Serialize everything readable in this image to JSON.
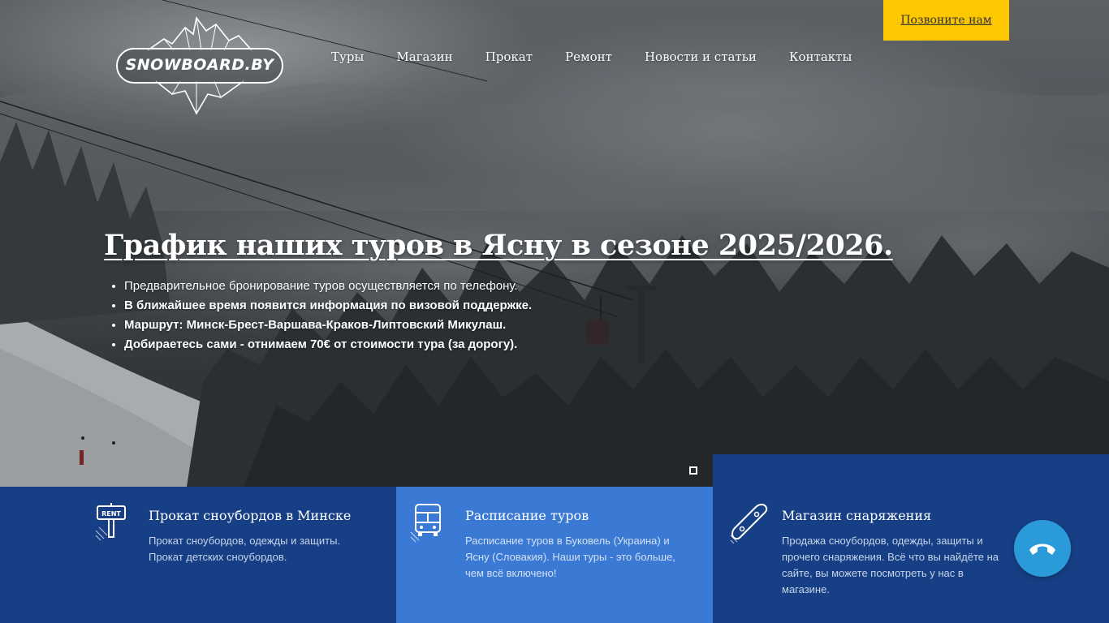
{
  "header": {
    "logo_text": "SNOWBOARD.BY",
    "nav": [
      "Туры",
      "Магазин",
      "Прокат",
      "Ремонт",
      "Новости и статьи",
      "Контакты"
    ],
    "call_label": "Позвоните нам"
  },
  "hero": {
    "title": "График наших туров в Ясну в сезоне 2025/2026.",
    "bullets": [
      "Предварительное бронирование туров осуществляется по телефону.",
      "В ближайшее время появится информация по визовой поддержке.",
      "Маршрут: Минск-Брест-Варшава-Краков-Липтовский Микулаш.",
      "Добираетесь сами - отнимаем 70€ от стоимости тура (за дорогу)."
    ]
  },
  "features": [
    {
      "icon": "rent-sign-icon",
      "title": "Прокат сноубордов в Минске",
      "desc": "Прокат сноубордов, одежды и защиты. Прокат детских сноубордов."
    },
    {
      "icon": "bus-icon",
      "title": "Расписание туров",
      "desc": "Расписание туров в Буковель (Украина) и Ясну (Словакия). Наши туры - это больше, чем всё включено!"
    },
    {
      "icon": "snowboard-icon",
      "title": "Магазин снаряжения",
      "desc": "Продажа сноубордов, одежды, защиты и прочего снаряжения. Всё что вы найдёте на сайте, вы можете посмотреть у нас в магазине."
    }
  ],
  "colors": {
    "accent_yellow": "#fdc800",
    "dark_blue": "#163f85",
    "light_blue": "#3a7ad4",
    "phone_button": "#2b9ad8"
  }
}
